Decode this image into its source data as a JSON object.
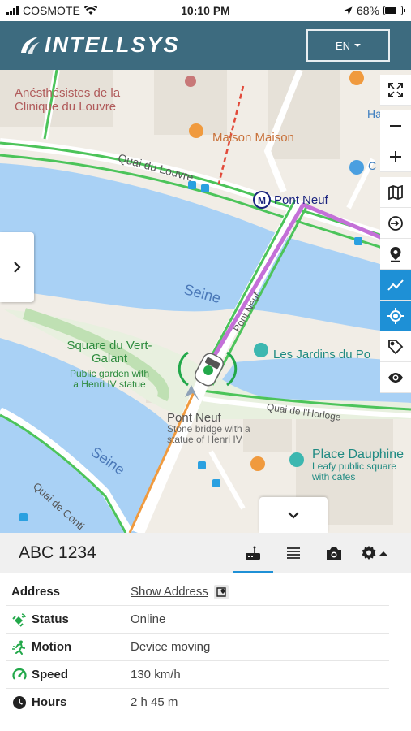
{
  "status_bar": {
    "carrier": "COSMOTE",
    "time": "10:10 PM",
    "battery": "68%",
    "battery_level": 0.68
  },
  "header": {
    "logo": "INTELLSYS",
    "language": "EN"
  },
  "map": {
    "labels": {
      "clinic": "Anésthésistes de la Clinique du Louvre",
      "maison": "Maison Maison",
      "habitat": "Habitat",
      "quai_louvre": "Quai du Louvre",
      "metro": "Pont Neuf",
      "seine_1": "Seine",
      "seine_2": "Seine",
      "pont_neuf_road": "Pont Neuf",
      "square": "Square du Vert-Galant",
      "square_desc": "Public garden with a Henri IV statue",
      "jardins": "Les Jardins du Po",
      "quai_horloge": "Quai de l'Horloge",
      "pont_neuf_poi": "Pont Neuf",
      "pont_neuf_desc": "Stone bridge with a statue of Henri IV",
      "dauphine": "Place Dauphine",
      "dauphine_desc": "Leafy public square with cafes",
      "quai_conti": "Quai de Conti",
      "c_label": "C"
    },
    "tools": [
      "fullscreen-icon",
      "zoom-out-icon",
      "zoom-in-icon",
      "map-layers-icon",
      "login-icon",
      "location-pin-icon",
      "route-line-icon",
      "locate-target-icon",
      "tag-icon",
      "eye-icon"
    ],
    "colors": {
      "water": "#a9d1f5",
      "route": "#c470d8",
      "road_green": "#4cc45a",
      "active_tool": "#1e90d6"
    }
  },
  "panel": {
    "plate": "ABC 1234",
    "tabs": [
      "device-icon",
      "list-icon",
      "camera-icon",
      "gear-icon"
    ],
    "rows": [
      {
        "label": "Address",
        "value": "Show Address"
      },
      {
        "label": "Status",
        "value": "Online"
      },
      {
        "label": "Motion",
        "value": "Device moving"
      },
      {
        "label": "Speed",
        "value": "130 km/h"
      },
      {
        "label": "Hours",
        "value": "2 h 45 m"
      }
    ]
  }
}
